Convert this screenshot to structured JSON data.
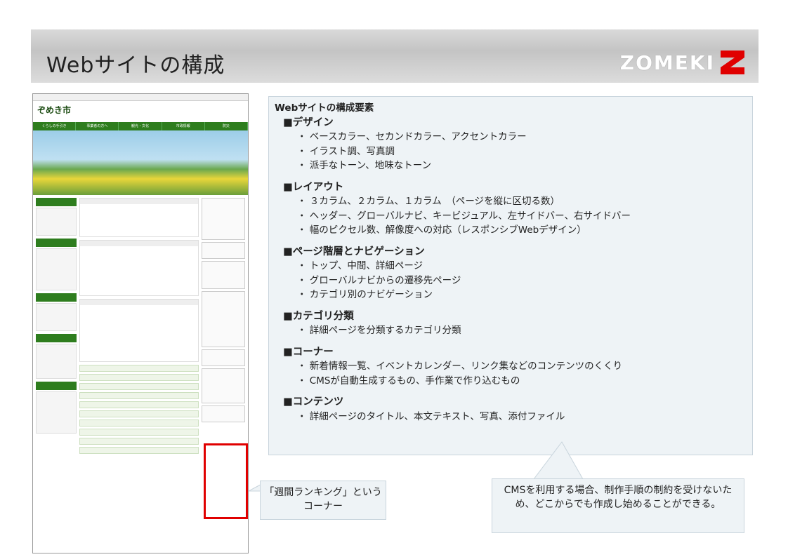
{
  "slide": {
    "title": "Webサイトの構成",
    "logo_text": "ZOMEKI",
    "logo_color": "#e00000"
  },
  "screenshot": {
    "site_name": "ぞめき市",
    "nav": [
      "くらしの手引き",
      "事業者の方へ",
      "観光・文化",
      "市政情報",
      "防災"
    ],
    "ranking_label": "週間ランキング"
  },
  "panel": {
    "heading": "Webサイトの構成要素",
    "sections": [
      {
        "title": "■デザイン",
        "items": [
          "・ ベースカラー、セカンドカラー、アクセントカラー",
          "・ イラスト調、写真調",
          "・ 派手なトーン、地味なトーン"
        ]
      },
      {
        "title": "■レイアウト",
        "items": [
          "・ ３カラム、２カラム、１カラム　（ページを縦に区切る数）",
          "・ ヘッダー、グローバルナビ、キービジュアル、左サイドバー、右サイドバー",
          "・ 幅のピクセル数、解像度への対応（レスポンシブWebデザイン）"
        ]
      },
      {
        "title": "■ページ階層とナビゲーション",
        "items": [
          "・ トップ、中間、詳細ページ",
          "・ グローバルナビからの遷移先ページ",
          "・ カテゴリ別のナビゲーション"
        ]
      },
      {
        "title": "■カテゴリ分類",
        "items": [
          "・ 詳細ページを分類するカテゴリ分類"
        ]
      },
      {
        "title": "■コーナー",
        "items": [
          "・ 新着情報一覧、イベントカレンダー、リンク集などのコンテンツのくくり",
          "・ CMSが自動生成するもの、手作業で作り込むもの"
        ]
      },
      {
        "title": "■コンテンツ",
        "items": [
          "・ 詳細ページのタイトル、本文テキスト、写真、添付ファイル"
        ]
      }
    ]
  },
  "callouts": {
    "ranking": "「週間ランキング」という コーナー",
    "cms": "CMSを利用する場合、制作手順の制約を受けないため、どこからでも作成し始めることができる。"
  }
}
